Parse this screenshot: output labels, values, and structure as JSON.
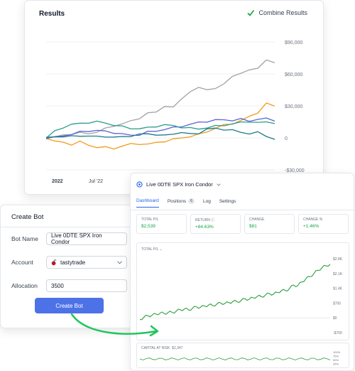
{
  "results": {
    "title": "Results",
    "combine_label": "Combine Results",
    "combine_checked": true,
    "chart_data": {
      "type": "line",
      "x_ticks": [
        "2022",
        "Jul '22"
      ],
      "y_ticks": [
        "$90,000",
        "$60,000",
        "$30,000",
        "0",
        "-$30,000"
      ],
      "ylim": [
        -30000,
        90000
      ],
      "series": [
        {
          "color": "#a3a3a3",
          "values": [
            0,
            1500,
            2000,
            3500,
            5500,
            3000,
            6000,
            9000,
            10500,
            14000,
            15500,
            18000,
            24000,
            23500,
            30000,
            29000,
            36000,
            44000,
            47000,
            45000,
            47000,
            50000,
            58000,
            61000,
            63000,
            66000,
            73000,
            70000
          ]
        },
        {
          "color": "#f29b1b",
          "values": [
            0,
            -3000,
            -4500,
            -6000,
            -3500,
            -7000,
            -8500,
            -9000,
            -10000,
            -7500,
            -6000,
            -5500,
            -6000,
            -4500,
            -3000,
            -1500,
            0,
            1500,
            3000,
            6000,
            9000,
            12000,
            13500,
            16000,
            20000,
            24000,
            32000,
            30000
          ]
        },
        {
          "color": "#5b63d6",
          "values": [
            0,
            500,
            2000,
            3500,
            5500,
            6500,
            7000,
            6000,
            5000,
            3500,
            2500,
            3000,
            5500,
            6500,
            8000,
            9500,
            11000,
            12500,
            14500,
            15500,
            16500,
            17000,
            16500,
            17500,
            16000,
            17500,
            18000,
            16500
          ]
        },
        {
          "color": "#2a9d8f",
          "values": [
            0,
            6000,
            10000,
            12500,
            13500,
            14500,
            15000,
            14000,
            12000,
            10500,
            9000,
            8500,
            9500,
            11000,
            12000,
            11500,
            10000,
            9000,
            8500,
            9500,
            11000,
            12000,
            13000,
            14500,
            15500,
            14000,
            15000,
            14000
          ]
        },
        {
          "color": "#1f7a8c",
          "values": [
            0,
            1000,
            1500,
            1200,
            2000,
            1800,
            1000,
            1500,
            500,
            1000,
            2000,
            3000,
            4000,
            3000,
            2000,
            4000,
            5000,
            3500,
            4500,
            8000,
            9000,
            8000,
            7000,
            5500,
            4000,
            5000,
            2000,
            -1500
          ]
        }
      ]
    }
  },
  "create_bot": {
    "title": "Create Bot",
    "bot_name_label": "Bot Name",
    "bot_name_value": "Live 0DTE SPX Iron Condor",
    "account_label": "Account",
    "account_value": "tastytrade",
    "allocation_label": "Allocation",
    "allocation_value": "3500",
    "button_label": "Create Bot"
  },
  "bot_panel": {
    "title": "Live 0DTE SPX Iron Condor",
    "tabs": [
      {
        "label": "Dashboard",
        "active": true
      },
      {
        "label": "Positions",
        "badge": "6"
      },
      {
        "label": "Log"
      },
      {
        "label": "Settings"
      }
    ],
    "stats": [
      {
        "label": "TOTAL P/L",
        "value": "$2,539"
      },
      {
        "label": "RETURN ⓘ",
        "value": "+84.63%"
      },
      {
        "label": "CHANGE",
        "value": "$81"
      },
      {
        "label": "CHANGE %",
        "value": "+1.46%"
      }
    ],
    "pl_label": "TOTAL P/L",
    "pl_chart": {
      "type": "line",
      "y_ticks": [
        "$2.8K",
        "$2.1K",
        "$1.4K",
        "$700",
        "$0",
        "-$700"
      ],
      "ylim": [
        -700,
        2800
      ],
      "color": "#2e9e3e",
      "values": [
        -80,
        30,
        100,
        120,
        180,
        230,
        200,
        260,
        250,
        320,
        380,
        420,
        380,
        450,
        520,
        500,
        560,
        610,
        580,
        650,
        700,
        680,
        720,
        780,
        760,
        820,
        900,
        880,
        950,
        1020,
        1000,
        1080,
        1150,
        1120,
        1200,
        1300,
        1280,
        1400,
        1550,
        1520,
        1700,
        1850,
        1950,
        2100,
        2250,
        2380,
        2460,
        2539
      ]
    },
    "risk_label": "CAPITAL AT RISK",
    "risk_value": "$1,347",
    "risk_ticks": [
      "100%",
      "75%",
      "50%",
      "25%"
    ]
  }
}
